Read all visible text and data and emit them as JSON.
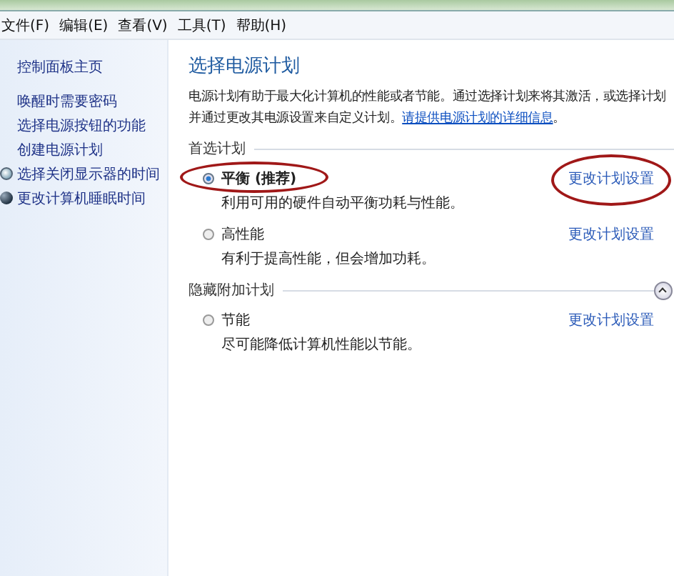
{
  "menu_bar": [
    "文件(F)",
    "编辑(E)",
    "查看(V)",
    "工具(T)",
    "帮助(H)"
  ],
  "sidebar": {
    "items": [
      {
        "label": "控制面板主页",
        "kind": "home"
      },
      {
        "label": "唤醒时需要密码",
        "kind": "link"
      },
      {
        "label": "选择电源按钮的功能",
        "kind": "link"
      },
      {
        "label": "创建电源计划",
        "kind": "link"
      },
      {
        "label": "选择关闭显示器的时间",
        "kind": "icon-link"
      },
      {
        "label": "更改计算机睡眠时间",
        "kind": "icon-link"
      }
    ]
  },
  "main": {
    "title": "选择电源计划",
    "description": "电源计划有助于最大化计算机的性能或者节能。通过选择计划来将其激活，或选择计划并通过更改其电源设置来自定义计划。",
    "description_link": "请提供电源计划的详细信息",
    "description_end": "。",
    "groups": [
      {
        "label": "首选计划",
        "collapsible": false,
        "plans": [
          {
            "name": "平衡 (推荐)",
            "selected": true,
            "description": "利用可用的硬件自动平衡功耗与性能。",
            "link": "更改计划设置",
            "circled": true
          },
          {
            "name": "高性能",
            "selected": false,
            "description": "有利于提高性能，但会增加功耗。",
            "link": "更改计划设置",
            "circled": false
          }
        ]
      },
      {
        "label": "隐藏附加计划",
        "collapsible": true,
        "plans": [
          {
            "name": "节能",
            "selected": false,
            "description": "尽可能降低计算机性能以节能。",
            "link": "更改计划设置",
            "circled": false
          }
        ]
      }
    ]
  }
}
